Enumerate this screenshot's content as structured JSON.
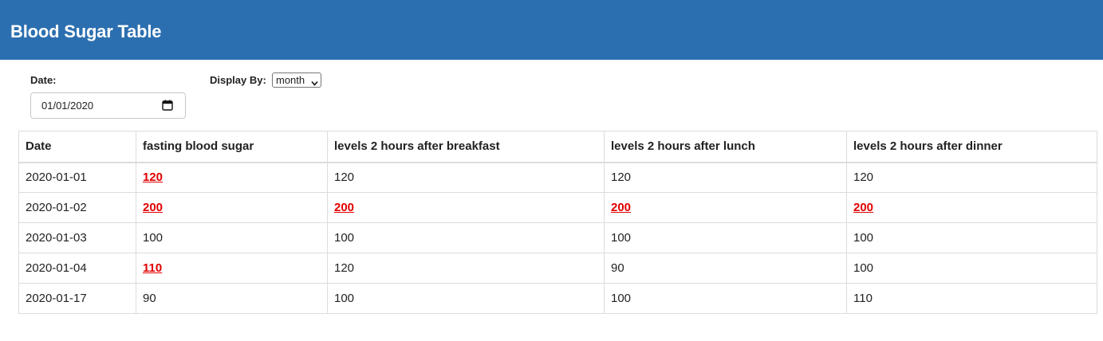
{
  "header": {
    "title": "Blood Sugar Table"
  },
  "filters": {
    "date_label": "Date:",
    "date_value": "01/01/2020",
    "display_label": "Display By:",
    "display_value": "month"
  },
  "table": {
    "columns": [
      "Date",
      "fasting blood sugar",
      "levels 2 hours after breakfast",
      "levels 2 hours after lunch",
      "levels 2 hours after dinner"
    ],
    "rows": [
      {
        "cells": [
          "2020-01-01",
          "120",
          "120",
          "120",
          "120"
        ],
        "high": [
          false,
          true,
          false,
          false,
          false
        ]
      },
      {
        "cells": [
          "2020-01-02",
          "200",
          "200",
          "200",
          "200"
        ],
        "high": [
          false,
          true,
          true,
          true,
          true
        ]
      },
      {
        "cells": [
          "2020-01-03",
          "100",
          "100",
          "100",
          "100"
        ],
        "high": [
          false,
          false,
          false,
          false,
          false
        ]
      },
      {
        "cells": [
          "2020-01-04",
          "110",
          "120",
          "90",
          "100"
        ],
        "high": [
          false,
          true,
          false,
          false,
          false
        ]
      },
      {
        "cells": [
          "2020-01-17",
          "90",
          "100",
          "100",
          "110"
        ],
        "high": [
          false,
          false,
          false,
          false,
          false
        ]
      }
    ]
  },
  "colors": {
    "header_bg": "#2c6fb0",
    "high_value": "#e00000"
  }
}
